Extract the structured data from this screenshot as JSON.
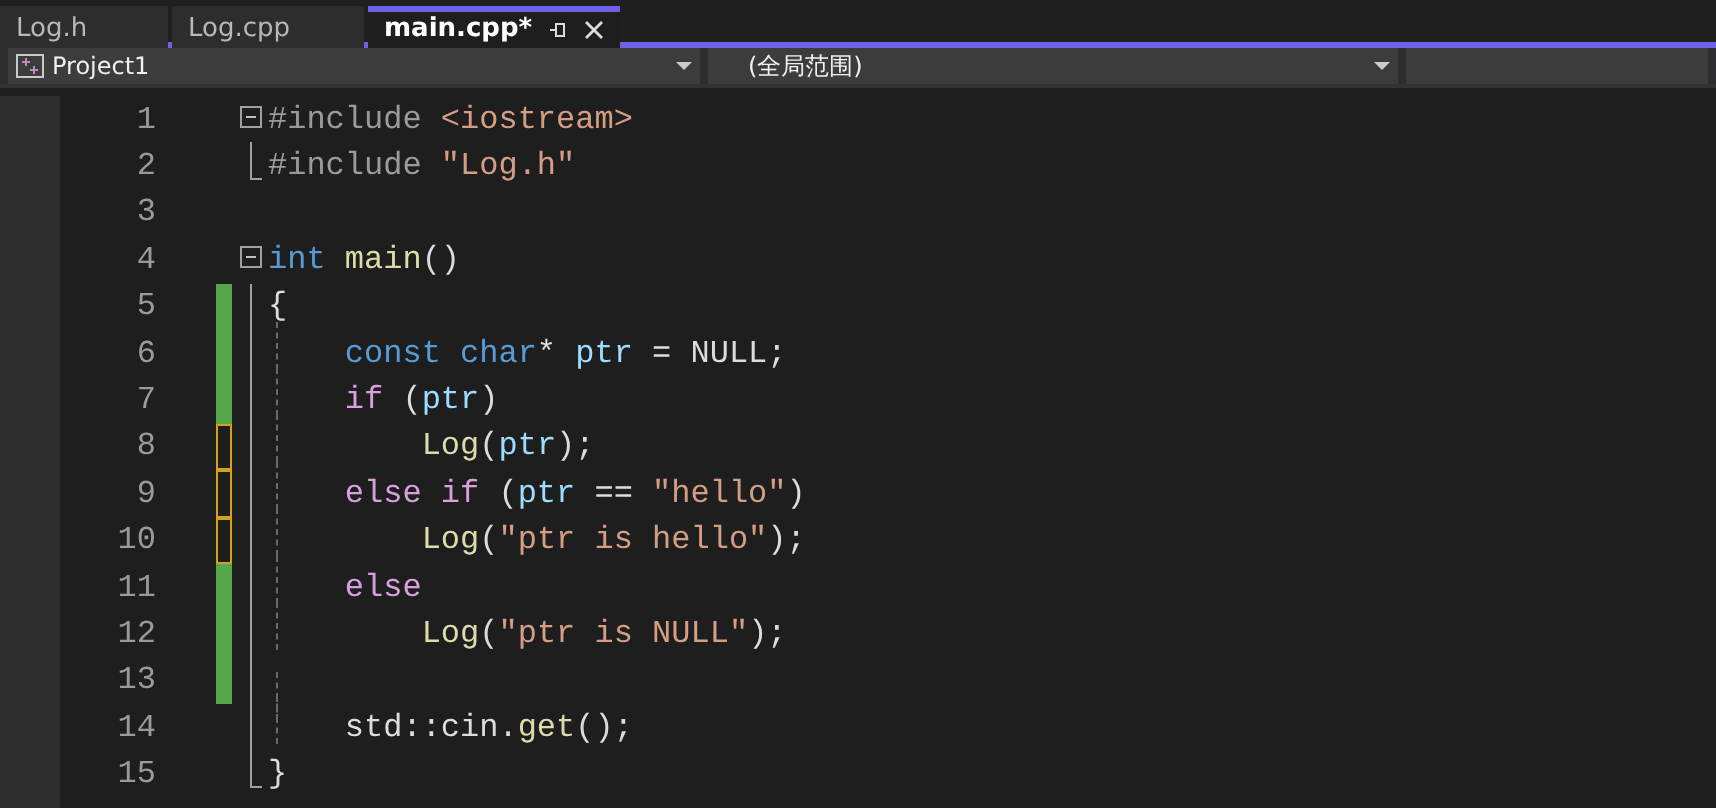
{
  "tabs": [
    {
      "label": "Log.h",
      "selected": false
    },
    {
      "label": "Log.cpp",
      "selected": false
    },
    {
      "label": "main.cpp*",
      "selected": true
    }
  ],
  "nav_bar": {
    "project": "Project1",
    "scope": "(全局范围)"
  },
  "lines": [
    {
      "number": "1",
      "fold_start": true,
      "tokens": [
        {
          "kind": "preproc",
          "text": "#include "
        },
        {
          "kind": "string",
          "text": "<iostream>"
        }
      ]
    },
    {
      "number": "2",
      "fold_end": true,
      "tokens": [
        {
          "kind": "preproc",
          "text": "#include "
        },
        {
          "kind": "string",
          "text": "\"Log.h\""
        }
      ]
    },
    {
      "number": "3"
    },
    {
      "number": "4",
      "fold_start": true,
      "tokens": [
        {
          "kind": "keyword",
          "text": "int "
        },
        {
          "kind": "function",
          "text": "main"
        },
        {
          "kind": "plain",
          "text": "()"
        }
      ]
    },
    {
      "number": "5",
      "in_block": true,
      "saved_change": true,
      "tokens": [
        {
          "kind": "plain",
          "text": "{"
        }
      ]
    },
    {
      "number": "6",
      "in_block": true,
      "saved_change": true,
      "tokens": [
        {
          "kind": "keyword",
          "text": "    const char"
        },
        {
          "kind": "plain",
          "text": "* "
        },
        {
          "kind": "variable",
          "text": "ptr"
        },
        {
          "kind": "plain",
          "text": " = NULL;"
        }
      ]
    },
    {
      "number": "7",
      "in_block": true,
      "saved_change": true,
      "tokens": [
        {
          "kind": "control",
          "text": "    if"
        },
        {
          "kind": "plain",
          "text": " ("
        },
        {
          "kind": "variable",
          "text": "ptr"
        },
        {
          "kind": "plain",
          "text": ")"
        }
      ]
    },
    {
      "number": "8",
      "in_block": true,
      "unsaved_change": true,
      "tokens": [
        {
          "kind": "function",
          "text": "        Log"
        },
        {
          "kind": "plain",
          "text": "("
        },
        {
          "kind": "variable",
          "text": "ptr"
        },
        {
          "kind": "plain",
          "text": ");"
        }
      ]
    },
    {
      "number": "9",
      "in_block": true,
      "unsaved_change": true,
      "tokens": [
        {
          "kind": "control",
          "text": "    else if"
        },
        {
          "kind": "plain",
          "text": " ("
        },
        {
          "kind": "variable",
          "text": "ptr"
        },
        {
          "kind": "plain",
          "text": " == "
        },
        {
          "kind": "string",
          "text": "\"hello\""
        },
        {
          "kind": "plain",
          "text": ")"
        }
      ]
    },
    {
      "number": "10",
      "in_block": true,
      "unsaved_change": true,
      "tokens": [
        {
          "kind": "function",
          "text": "        Log"
        },
        {
          "kind": "plain",
          "text": "("
        },
        {
          "kind": "string",
          "text": "\"ptr is hello\""
        },
        {
          "kind": "plain",
          "text": ");"
        }
      ]
    },
    {
      "number": "11",
      "in_block": true,
      "saved_change": true,
      "tokens": [
        {
          "kind": "control",
          "text": "    else"
        }
      ]
    },
    {
      "number": "12",
      "in_block": true,
      "saved_change": true,
      "tokens": [
        {
          "kind": "function",
          "text": "        Log"
        },
        {
          "kind": "plain",
          "text": "("
        },
        {
          "kind": "string",
          "text": "\"ptr is NULL\""
        },
        {
          "kind": "plain",
          "text": ");"
        }
      ]
    },
    {
      "number": "13",
      "in_block": true,
      "saved_change": true
    },
    {
      "number": "14",
      "in_block": true,
      "tokens": [
        {
          "kind": "plain",
          "text": "    std::cin."
        },
        {
          "kind": "function",
          "text": "get"
        },
        {
          "kind": "plain",
          "text": "();"
        }
      ]
    },
    {
      "number": "15",
      "fold_end": true,
      "tokens": [
        {
          "kind": "plain",
          "text": "}"
        }
      ]
    }
  ]
}
